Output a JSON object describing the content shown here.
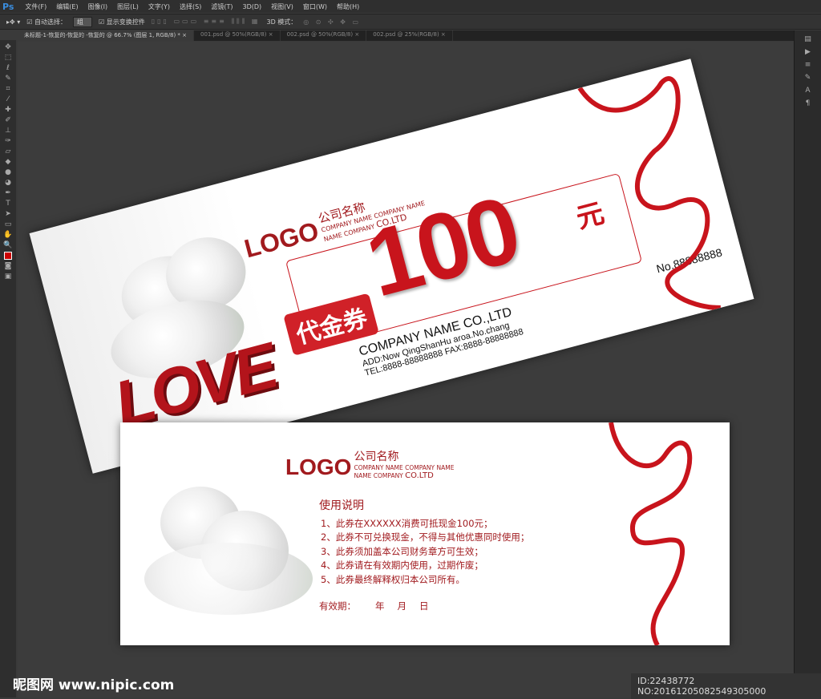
{
  "app": {
    "logo": "Ps"
  },
  "menu": [
    "文件(F)",
    "编辑(E)",
    "图像(I)",
    "图层(L)",
    "文字(Y)",
    "选择(S)",
    "滤镜(T)",
    "3D(D)",
    "视图(V)",
    "窗口(W)",
    "帮助(H)"
  ],
  "options": {
    "auto_select_label": "自动选择：",
    "auto_select_value": "组",
    "show_transform_label": "显示变换控件",
    "mode_3d_label": "3D 模式："
  },
  "tabs": [
    "未标题-1-恢复的-恢复的 -恢复的 @ 66.7% (图层 1, RGB/8) *",
    "001.psd @ 50%(RGB/8)",
    "002.psd @ 50%(RGB/8)",
    "002.psd @ 25%(RGB/8)"
  ],
  "voucher_front": {
    "logo": "LOGO",
    "company_cn": "公司名称",
    "company_en1": "COMPANY NAME COMPANY NAME",
    "company_en2a": "NAME COMPANY",
    "company_en2b": "CO.LTD",
    "amount": "100",
    "unit": "元",
    "badge": "代金券",
    "love": "LOVE",
    "company": "COMPANY NAME CO.,LTD",
    "address": "ADD:Now QingShanHu aroa.No.chang",
    "contact": "TEL:8888-88888888  FAX:8888-88888888",
    "number": "No.88888888"
  },
  "voucher_back": {
    "logo": "LOGO",
    "company_cn": "公司名称",
    "company_en1": "COMPANY NAME COMPANY NAME",
    "company_en2a": "NAME COMPANY",
    "company_en2b": "CO.LTD",
    "rules_title": "使用说明",
    "rules": [
      "1、此券在XXXXXX消费可抵现金100元；",
      "2、此券不可兑换现金，不得与其他优惠同时使用；",
      "3、此券须加盖本公司财务章方可生效；",
      "4、此券请在有效期内使用，过期作废；",
      "5、此券最终解释权归本公司所有。"
    ],
    "validity_label": "有效期：",
    "year": "年",
    "month": "月",
    "day": "日"
  },
  "watermark": {
    "site": "昵图网 www.nipic.com",
    "id": "ID:22438772 NO:20161205082549305000"
  }
}
